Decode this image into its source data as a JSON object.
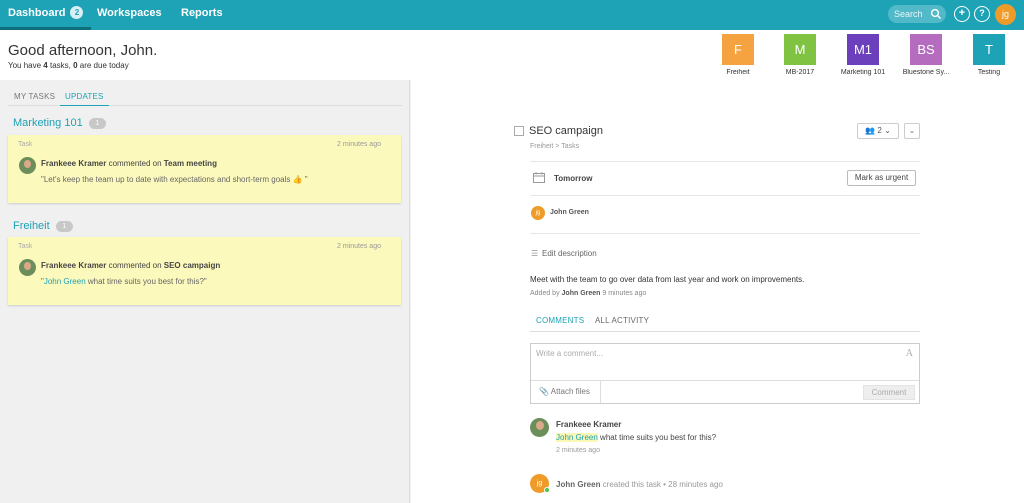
{
  "nav": {
    "dashboard": "Dashboard",
    "dashboard_badge": "2",
    "workspaces": "Workspaces",
    "reports": "Reports",
    "search_placeholder": "Search",
    "add_icon": "+",
    "help_icon": "?",
    "user_initials": "jg"
  },
  "header": {
    "greeting": "Good afternoon, John.",
    "sub_prefix": "You have ",
    "task_count": "4",
    "sub_mid": " tasks, ",
    "due_count": "0",
    "sub_suffix": " are due today"
  },
  "workspaces": [
    {
      "initials": "F",
      "label": "Freiheit",
      "color": "#f4a340"
    },
    {
      "initials": "M",
      "label": "MB-2017",
      "color": "#80c242"
    },
    {
      "initials": "M1",
      "label": "Marketing 101",
      "color": "#6c3fbd"
    },
    {
      "initials": "BS",
      "label": "Bluestone Sy...",
      "color": "#b56cbe"
    },
    {
      "initials": "T",
      "label": "Testing",
      "color": "#1ea2b5"
    }
  ],
  "left_tabs": {
    "my_tasks": "MY TASKS",
    "updates": "UPDATES"
  },
  "groups": [
    {
      "title": "Marketing 101",
      "count": "1",
      "card": {
        "type": "Task",
        "time": "2 minutes ago",
        "author": "Frankeee Kramer",
        "action": " commented on ",
        "target": "Team meeting",
        "body": "\"Let's keep the team up to date with expectations and short-term goals 👍 \""
      }
    },
    {
      "title": "Freiheit",
      "count": "1",
      "card": {
        "type": "Task",
        "time": "2 minutes ago",
        "author": "Frankeee Kramer",
        "action": " commented on ",
        "target": "SEO campaign",
        "body_open": "\"",
        "mention": "John Green",
        "body": " what time suits you best for this?\""
      }
    }
  ],
  "task": {
    "title": "SEO campaign",
    "members": "2",
    "breadcrumb": "Freiheit > Tasks",
    "due": "Tomorrow",
    "urgent_label": "Mark as urgent",
    "assignee_initials": "jg",
    "assignee": "John Green",
    "edit_description": "Edit description",
    "description": "Meet with the team to go over data from last year and work on improvements.",
    "added_prefix": "Added by ",
    "added_by": "John Green",
    "added_time": " 9 minutes ago"
  },
  "comments": {
    "tab_comments": "COMMENTS",
    "tab_activity": "ALL ACTIVITY",
    "placeholder": "Write a comment...",
    "format_icon": "A",
    "attach": "Attach files",
    "submit": "Comment",
    "items": [
      {
        "author": "Frankeee Kramer",
        "mention": "John Green",
        "text": " what time suits you best for this?",
        "time": "2 minutes ago"
      }
    ],
    "activity": {
      "initials": "jg",
      "author": "John Green",
      "action": " created this task",
      "time": " • 28 minutes ago"
    }
  }
}
